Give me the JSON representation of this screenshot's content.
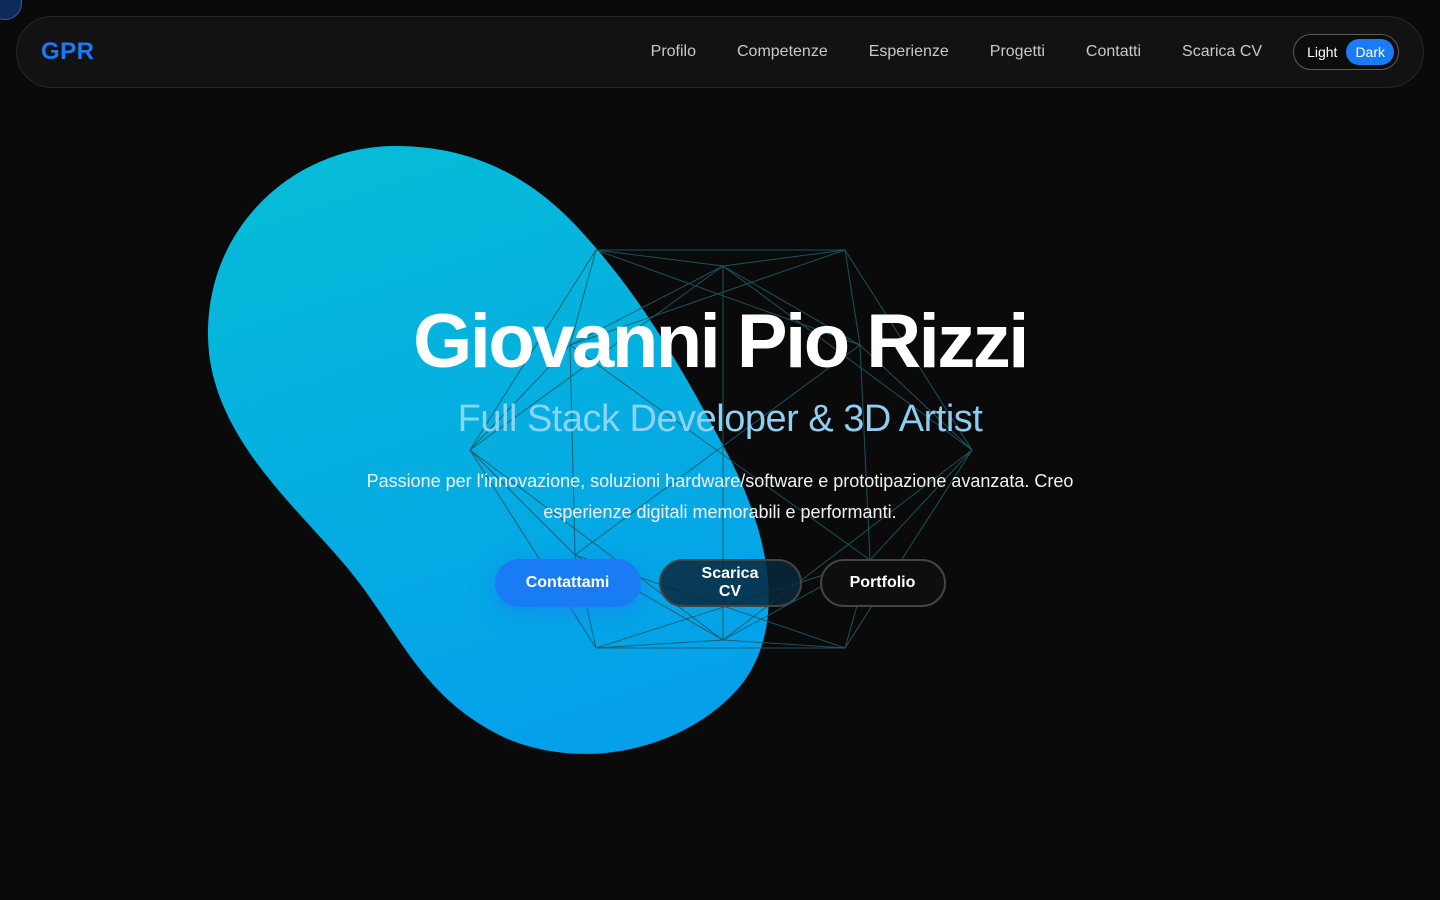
{
  "nav": {
    "logo": "GPR",
    "links": [
      "Profilo",
      "Competenze",
      "Esperienze",
      "Progetti",
      "Contatti",
      "Scarica CV"
    ],
    "theme": {
      "light_label": "Light",
      "dark_label": "Dark",
      "active": "Dark"
    }
  },
  "hero": {
    "title": "Giovanni Pio Rizzi",
    "subtitle": "Full Stack Developer & 3D Artist",
    "description": "Passione per l'innovazione, soluzioni hardware/software e prototipazione avanzata. Creo esperienze digitali memorabili e performanti.",
    "buttons": {
      "contact": "Contattami",
      "cv": "Scarica CV",
      "portfolio": "Portfolio"
    }
  },
  "colors": {
    "accent": "#1a7cf5",
    "background": "#0a0a0a",
    "blob_top": "#06bbd8",
    "blob_bottom": "#04a0ea"
  }
}
